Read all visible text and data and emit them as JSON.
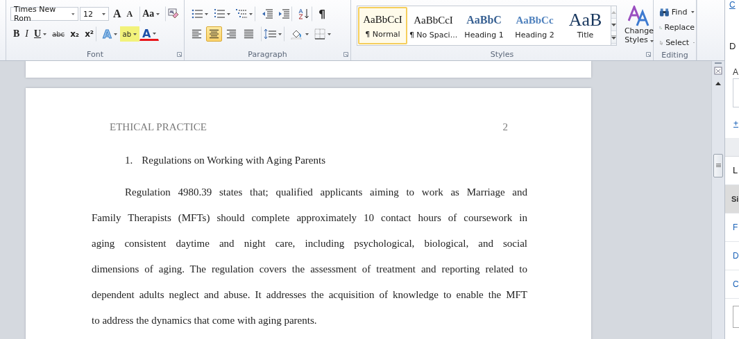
{
  "ribbon": {
    "font": {
      "label": "Font",
      "font_name": "Times New Rom",
      "font_size": "12",
      "row1": [
        {
          "kind": "grow",
          "glyph": "A"
        },
        {
          "kind": "shrink",
          "glyph": "A"
        },
        {
          "kind": "case",
          "glyph": "Aa"
        },
        {
          "kind": "clear"
        }
      ],
      "row2": [
        {
          "kind": "bold",
          "glyph": "B"
        },
        {
          "kind": "italic",
          "glyph": "I"
        },
        {
          "kind": "underline",
          "glyph": "U"
        },
        {
          "kind": "strike",
          "glyph": "abc"
        },
        {
          "kind": "sub",
          "glyph": "x₂"
        },
        {
          "kind": "sup",
          "glyph": "x²"
        },
        {
          "kind": "effects",
          "glyph": "A"
        },
        {
          "kind": "highlight",
          "glyph": "ab"
        },
        {
          "kind": "color",
          "glyph": "A"
        }
      ]
    },
    "paragraph": {
      "label": "Paragraph",
      "row1": [
        {
          "kind": "bullets"
        },
        {
          "kind": "numbering"
        },
        {
          "kind": "multilevel"
        },
        {
          "kind": "outdent"
        },
        {
          "kind": "indent"
        },
        {
          "kind": "sort"
        },
        {
          "kind": "marks",
          "glyph": "¶"
        }
      ],
      "alignments": [
        {
          "kind": "left",
          "selected": false
        },
        {
          "kind": "center",
          "selected": true
        },
        {
          "kind": "right",
          "selected": false
        },
        {
          "kind": "justify",
          "selected": false
        }
      ]
    },
    "styles": {
      "label": "Styles",
      "items": [
        {
          "kind": "normal",
          "preview": "AaBbCcI",
          "name": "¶ Normal",
          "selected": true
        },
        {
          "kind": "nospacing",
          "preview": "AaBbCcI",
          "name": "¶ No Spaci...",
          "selected": false
        },
        {
          "kind": "heading1",
          "preview": "AaBbC",
          "name": "Heading 1",
          "selected": false
        },
        {
          "kind": "heading2",
          "preview": "AaBbCc",
          "name": "Heading 2",
          "selected": false
        },
        {
          "kind": "title",
          "preview": "AaB",
          "name": "Title",
          "selected": false
        }
      ],
      "change_styles": "Change Styles"
    },
    "editing": {
      "label": "Editing",
      "items": [
        {
          "kind": "find",
          "label": "Find"
        },
        {
          "kind": "replace",
          "label": "Replace"
        },
        {
          "kind": "select",
          "label": "Select"
        }
      ]
    }
  },
  "document": {
    "header": "ETHICAL PRACTICE",
    "page_number": "2",
    "list_number": "1.",
    "heading": "Regulations on Working with Aging Parents",
    "lines": [
      "Regulation 4980.39 states that; qualified applicants aiming to work as Marriage and",
      "Family Therapists (MFTs) should complete approximately 10 contact hours of coursework in",
      "aging consistent daytime and night care, including psychological, biological, and social",
      "dimensions of aging. The regulation covers the assessment of treatment and reporting related to",
      "dependent adults neglect and abuse. It addresses the acquisition of knowledge to enable the MFT",
      "to address the dynamics that come with aging parents."
    ]
  },
  "side_pane": {
    "link": "C",
    "title": "D",
    "field_label": "A",
    "add": "+",
    "items": [
      {
        "label": "L",
        "kind": "header",
        "selected": false
      },
      {
        "label": "Si",
        "kind": "item",
        "selected": true
      },
      {
        "label": "F",
        "kind": "item",
        "selected": false
      },
      {
        "label": "D",
        "kind": "item",
        "selected": false
      },
      {
        "label": "C",
        "kind": "item",
        "selected": false
      }
    ]
  }
}
